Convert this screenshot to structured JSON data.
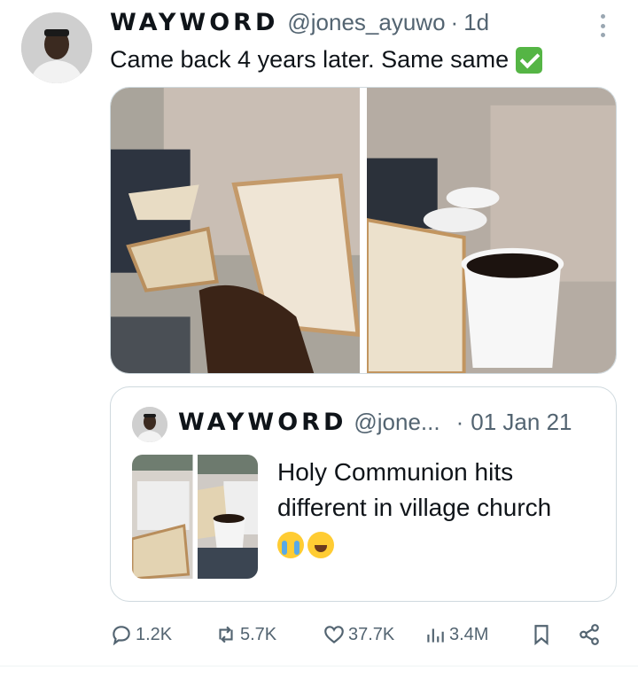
{
  "tweet": {
    "author_name": "WAYWORD",
    "handle": "@jones_ayuwo",
    "separator": "·",
    "time": "1d",
    "text": "Came back 4 years later. Same same",
    "text_emoji": "check-mark-button-emoji"
  },
  "quoted_tweet": {
    "author_name": "WAYWORD",
    "handle": "@jone...",
    "separator": "·",
    "time": "01 Jan 21",
    "text": "Holy Communion hits different in village church",
    "emojis": [
      "loudly-crying-face-emoji",
      "grinning-squinting-face-emoji"
    ]
  },
  "actions": {
    "replies": "1.2K",
    "reposts": "5.7K",
    "likes": "37.7K",
    "views": "3.4M"
  },
  "colors": {
    "text": "#0f1419",
    "secondary": "#536471",
    "border": "#cfd9de",
    "check_green": "#55b545"
  }
}
